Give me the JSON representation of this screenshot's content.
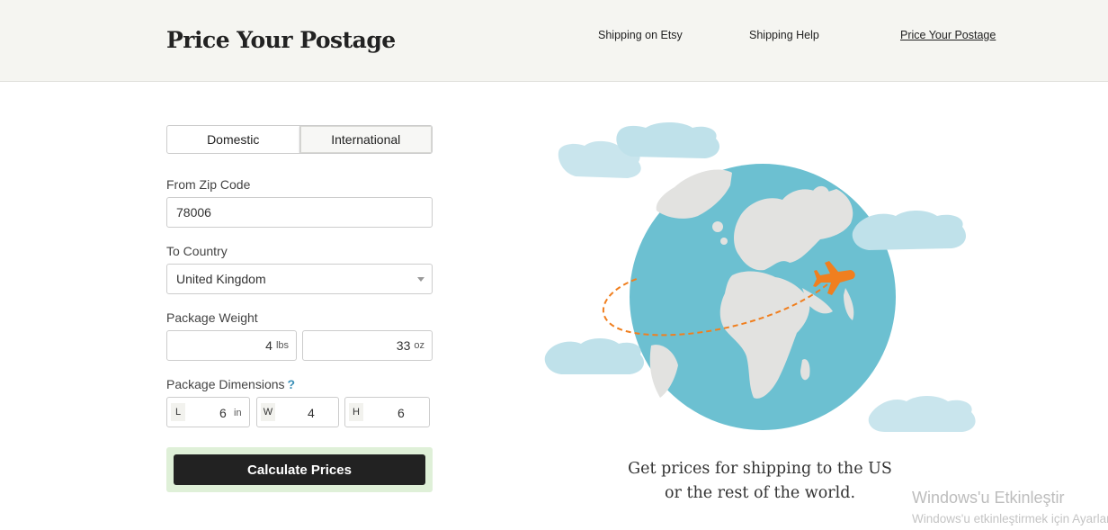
{
  "header": {
    "title": "Price Your Postage",
    "nav": [
      {
        "label": "Shipping on Etsy"
      },
      {
        "label": "Shipping Help"
      },
      {
        "label": "Price Your Postage"
      }
    ]
  },
  "form": {
    "tabs": [
      {
        "label": "Domestic",
        "selected": false
      },
      {
        "label": "International",
        "selected": true
      }
    ],
    "from_zip": {
      "label": "From Zip Code",
      "value": "78006"
    },
    "to_country": {
      "label": "To Country",
      "value": "United Kingdom"
    },
    "package_weight": {
      "label": "Package Weight",
      "lbs_value": "4",
      "lbs_unit": "lbs",
      "oz_value": "33",
      "oz_unit": "oz"
    },
    "package_dimensions": {
      "label": "Package Dimensions",
      "help": "?",
      "length": {
        "prefix": "L",
        "value": "6",
        "unit": "in"
      },
      "width": {
        "prefix": "W",
        "value": "4"
      },
      "height": {
        "prefix": "H",
        "value": "6"
      }
    },
    "calculate_label": "Calculate Prices"
  },
  "hero": {
    "tagline_line1": "Get prices for shipping to the US",
    "tagline_line2": "or the rest of the world."
  },
  "watermark": {
    "title": "Windows'u Etkinleştir",
    "subtitle": "Windows'u etkinleştirmek için Ayarlar'a gidin."
  },
  "colors": {
    "header_bg": "#f5f5f1",
    "ocean": "#6cc0d1",
    "land": "#e2e2e0",
    "cloud": "#bfe1ea",
    "plane": "#f07f1f",
    "calc_wrap": "#dff0d8",
    "calc_btn": "#222222"
  }
}
